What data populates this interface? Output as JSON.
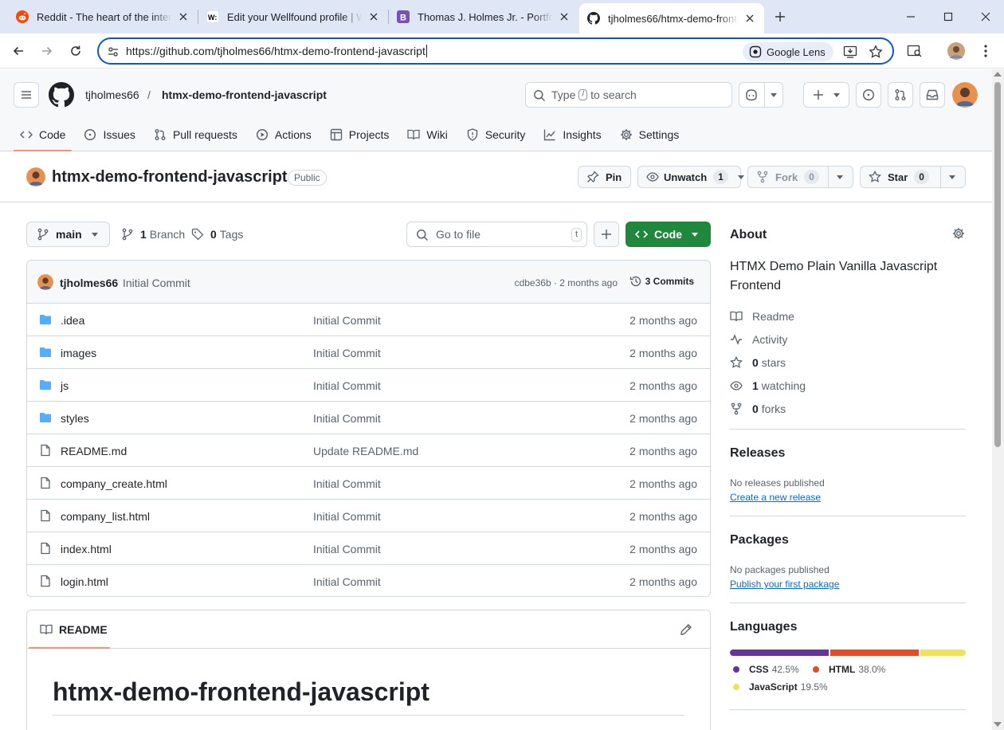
{
  "browser": {
    "tabs": [
      {
        "title": "Reddit - The heart of the internet",
        "icon": "reddit-icon"
      },
      {
        "title": "Edit your Wellfound profile | Wellfound",
        "icon": "wellfound-icon"
      },
      {
        "title": "Thomas J. Holmes Jr. - Portfolio",
        "icon": "bootstrap-icon"
      },
      {
        "title": "tjholmes66/htmx-demo-frontend-javascript",
        "icon": "github-icon"
      }
    ],
    "url": "https://github.com/tjholmes66/htmx-demo-frontend-javascript",
    "lens_label": "Google Lens"
  },
  "header": {
    "owner": "tjholmes66",
    "separator": "/",
    "repo": "htmx-demo-frontend-javascript",
    "search_prefix": "Type",
    "search_key": "/",
    "search_suffix": "to search"
  },
  "nav": [
    {
      "label": "Code",
      "icon": "code-icon"
    },
    {
      "label": "Issues",
      "icon": "issue-icon"
    },
    {
      "label": "Pull requests",
      "icon": "pull-request-icon"
    },
    {
      "label": "Actions",
      "icon": "play-icon"
    },
    {
      "label": "Projects",
      "icon": "table-icon"
    },
    {
      "label": "Wiki",
      "icon": "book-icon"
    },
    {
      "label": "Security",
      "icon": "shield-icon"
    },
    {
      "label": "Insights",
      "icon": "graph-icon"
    },
    {
      "label": "Settings",
      "icon": "gear-icon"
    }
  ],
  "repo": {
    "title": "htmx-demo-frontend-javascript",
    "visibility": "Public",
    "pin_label": "Pin",
    "unwatch_label": "Unwatch",
    "watch_count": "1",
    "fork_label": "Fork",
    "fork_count": "0",
    "star_label": "Star",
    "star_count": "0"
  },
  "files_toolbar": {
    "branch": "main",
    "branches_count": "1",
    "branches_label": "Branch",
    "tags_count": "0",
    "tags_label": "Tags",
    "go_to_file": "Go to file",
    "go_to_file_key": "t",
    "code_label": "Code"
  },
  "latest_commit": {
    "author": "tjholmes66",
    "message": "Initial Commit",
    "meta": "cdbe36b · 2 months ago",
    "commits_label": "3 Commits"
  },
  "files": [
    {
      "name": ".idea",
      "type": "folder",
      "message": "Initial Commit",
      "date": "2 months ago"
    },
    {
      "name": "images",
      "type": "folder",
      "message": "Initial Commit",
      "date": "2 months ago"
    },
    {
      "name": "js",
      "type": "folder",
      "message": "Initial Commit",
      "date": "2 months ago"
    },
    {
      "name": "styles",
      "type": "folder",
      "message": "Initial Commit",
      "date": "2 months ago"
    },
    {
      "name": "README.md",
      "type": "file",
      "message": "Update README.md",
      "date": "2 months ago"
    },
    {
      "name": "company_create.html",
      "type": "file",
      "message": "Initial Commit",
      "date": "2 months ago"
    },
    {
      "name": "company_list.html",
      "type": "file",
      "message": "Initial Commit",
      "date": "2 months ago"
    },
    {
      "name": "index.html",
      "type": "file",
      "message": "Initial Commit",
      "date": "2 months ago"
    },
    {
      "name": "login.html",
      "type": "file",
      "message": "Initial Commit",
      "date": "2 months ago"
    }
  ],
  "readme": {
    "tab_label": "README",
    "heading": "htmx-demo-frontend-javascript"
  },
  "about": {
    "title": "About",
    "description": "HTMX Demo Plain Vanilla Javascript Frontend",
    "readme": "Readme",
    "activity": "Activity",
    "stars_count": "0",
    "stars_label": "stars",
    "watching_count": "1",
    "watching_label": "watching",
    "forks_count": "0",
    "forks_label": "forks"
  },
  "releases": {
    "title": "Releases",
    "empty": "No releases published",
    "link": "Create a new release"
  },
  "packages": {
    "title": "Packages",
    "empty": "No packages published",
    "link": "Publish your first package"
  },
  "languages": {
    "title": "Languages",
    "items": [
      {
        "name": "CSS",
        "percent": 42.5,
        "label": "42.5%",
        "color": "#663399"
      },
      {
        "name": "HTML",
        "percent": 38.0,
        "label": "38.0%",
        "color": "#e34c26"
      },
      {
        "name": "JavaScript",
        "percent": 19.5,
        "label": "19.5%",
        "color": "#f1e05a"
      }
    ]
  },
  "colors": {
    "accent_green": "#1f883d",
    "link_blue": "#0969da",
    "folder_blue": "#54aeff",
    "nav_underline": "#fd8c73"
  }
}
